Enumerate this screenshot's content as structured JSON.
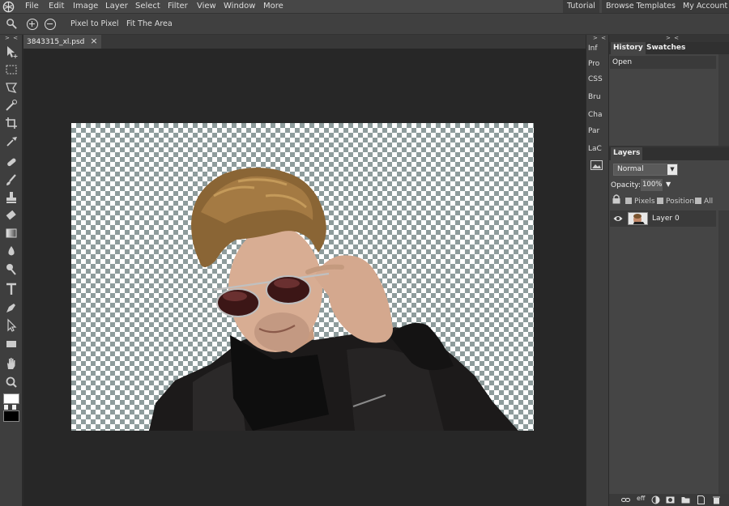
{
  "menubar": {
    "items": [
      "File",
      "Edit",
      "Image",
      "Layer",
      "Select",
      "Filter",
      "View",
      "Window",
      "More"
    ],
    "right": [
      "Tutorial",
      "Browse Templates",
      "My Account"
    ]
  },
  "optionsbar": {
    "pixel_to_pixel": "Pixel to Pixel",
    "fit_area": "Fit The Area"
  },
  "document": {
    "tab_title": "3843315_xl.psd",
    "close_glyph": "×"
  },
  "panels": {
    "collapse_glyph": "> <",
    "mini": [
      "Inf",
      "Pro",
      "CSS",
      "Bru",
      "Cha",
      "Par",
      "LaC"
    ],
    "history_tab": "History",
    "swatches_tab": "Swatches",
    "history_items": [
      "Open"
    ],
    "layers_tab": "Layers",
    "blend_mode": "Normal",
    "opacity_label": "Opacity:",
    "opacity_value": "100%",
    "lock_pixels": "Pixels",
    "lock_position": "Position",
    "lock_all": "All",
    "layers": [
      {
        "name": "Layer 0"
      }
    ],
    "footer_fx": "eff"
  },
  "colors": {
    "accent": "#474747",
    "canvas_bg": "#272727",
    "panel_bg": "#454545"
  },
  "icons": [
    "app-logo-icon",
    "search-icon",
    "zoom-in-icon",
    "zoom-out-icon",
    "move-tool-icon",
    "marquee-tool-icon",
    "lasso-tool-icon",
    "wand-tool-icon",
    "crop-tool-icon",
    "eyedropper-tool-icon",
    "healing-tool-icon",
    "brush-tool-icon",
    "stamp-tool-icon",
    "eraser-tool-icon",
    "gradient-tool-icon",
    "blur-tool-icon",
    "dodge-tool-icon",
    "text-tool-icon",
    "pen-tool-icon",
    "path-select-tool-icon",
    "shape-tool-icon",
    "hand-tool-icon",
    "zoom-tool-icon",
    "eye-icon",
    "lock-icon",
    "link-icon",
    "mask-icon",
    "folder-icon",
    "new-layer-icon",
    "trash-icon"
  ]
}
